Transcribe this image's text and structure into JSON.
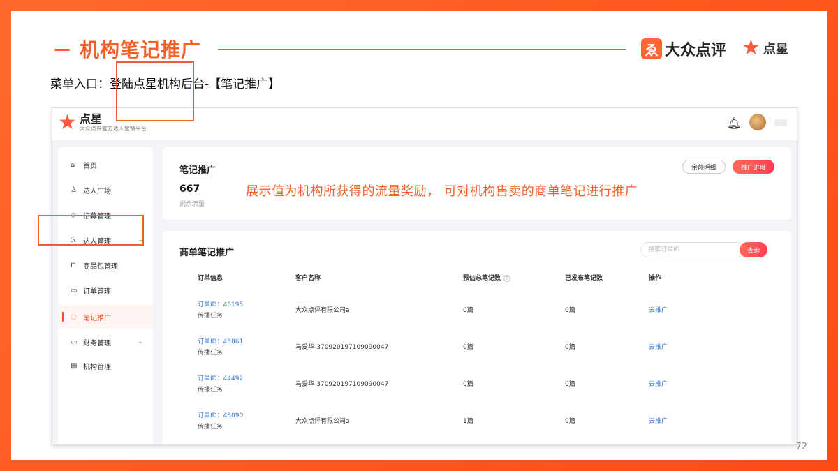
{
  "header": {
    "title": "机构笔记推广",
    "menu_entry": "菜单入口：登陆点星机构后台-【笔记推广】",
    "brand_dianping": "大众点评",
    "brand_dianxing": "点星",
    "page_number": "72"
  },
  "app": {
    "logo_title": "点星",
    "logo_subtitle": "大众点评官方达人营销平台"
  },
  "sidebar": {
    "items": [
      {
        "label": "首页",
        "icon": "home-icon"
      },
      {
        "label": "达人广场",
        "icon": "user-icon"
      },
      {
        "label": "招募管理",
        "icon": "tag-icon"
      },
      {
        "label": "达人管理",
        "icon": "users-icon"
      },
      {
        "label": "商品包管理",
        "icon": "package-icon"
      },
      {
        "label": "订单管理",
        "icon": "calendar-icon"
      },
      {
        "label": "笔记推广",
        "icon": "fire-icon"
      },
      {
        "label": "财务管理",
        "icon": "card-icon"
      },
      {
        "label": "机构管理",
        "icon": "doc-icon"
      }
    ]
  },
  "summary": {
    "title": "笔记推广",
    "value": "667",
    "sub": "剩余流量",
    "btn_detail": "余额明细",
    "btn_progress": "推广进度"
  },
  "annotation": "展示值为机构所获得的流量奖励， 可对机构售卖的商单笔记进行推广",
  "orders": {
    "title": "商单笔记推广",
    "search_placeholder": "搜索订单ID",
    "search_button": "查询",
    "columns": [
      "订单信息",
      "客户名称",
      "预估总笔记数",
      "已发布笔记数",
      "操作"
    ],
    "rows": [
      {
        "order_id": "订单ID：46195",
        "task": "传播任务",
        "customer": "大众点评有限公司a",
        "estimated": "0篇",
        "published": "0篇",
        "action": "去推广"
      },
      {
        "order_id": "订单ID：45861",
        "task": "传播任务",
        "customer": "马爱华-370920197109090047",
        "estimated": "0篇",
        "published": "0篇",
        "action": "去推广"
      },
      {
        "order_id": "订单ID：44492",
        "task": "传播任务",
        "customer": "马爱华-370920197109090047",
        "estimated": "0篇",
        "published": "0篇",
        "action": "去推广"
      },
      {
        "order_id": "订单ID：43090",
        "task": "传播任务",
        "customer": "大众点评有限公司a",
        "estimated": "1篇",
        "published": "0篇",
        "action": "去推广"
      }
    ]
  },
  "colors": {
    "accent": "#f2602a",
    "brand_red": "#ff4d2e",
    "link": "#3a7bd5"
  }
}
